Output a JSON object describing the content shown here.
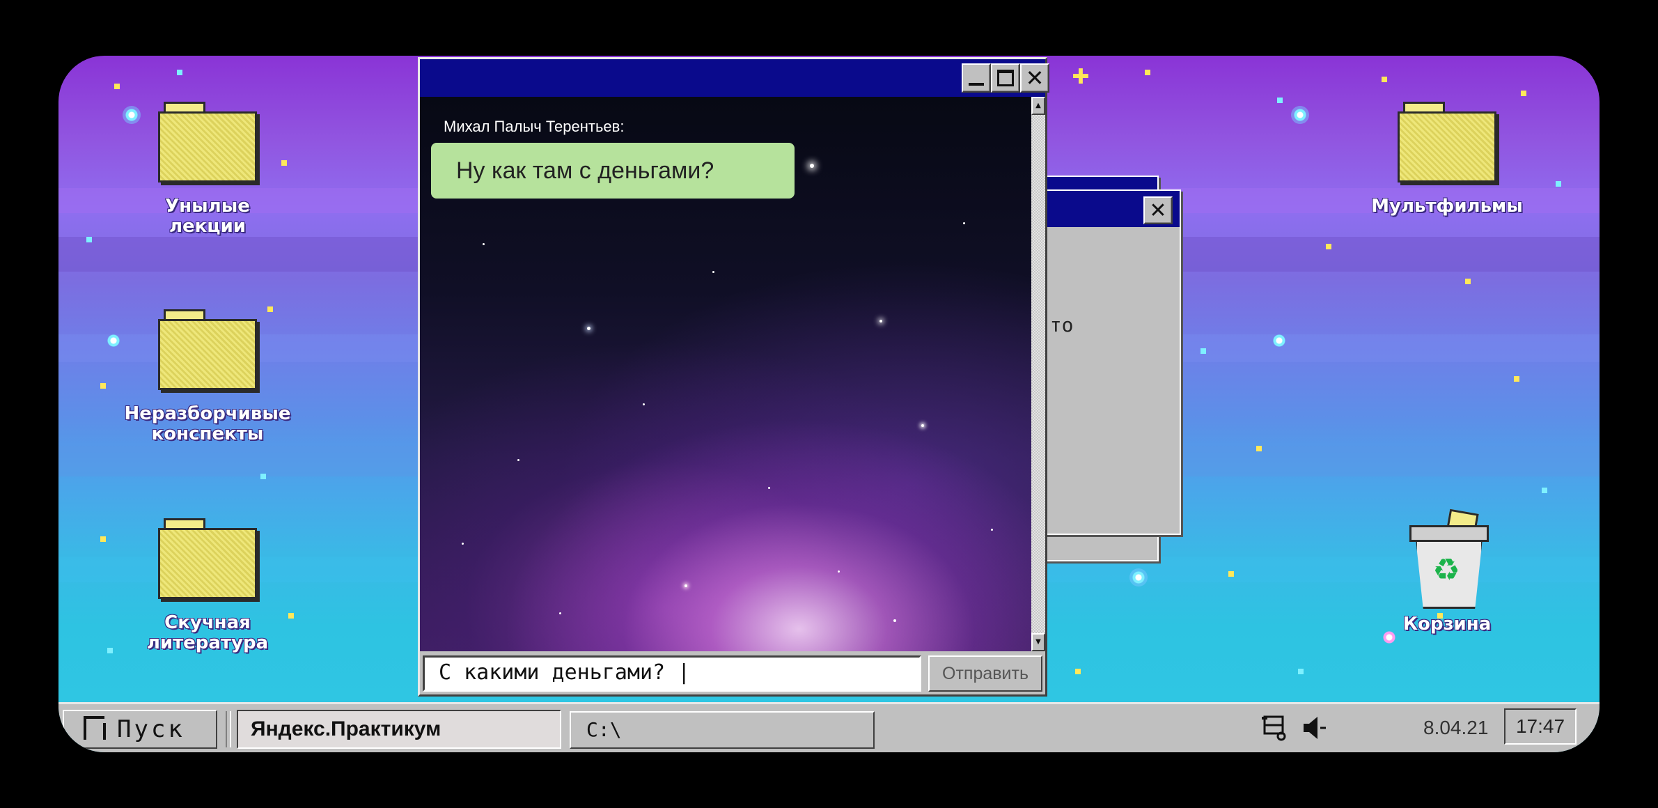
{
  "desktop": {
    "icons_left": [
      {
        "label_line1": "Унылые",
        "label_line2": "лекции"
      },
      {
        "label_line1": "Неразборчивые",
        "label_line2": "конспекты"
      },
      {
        "label_line1": "Скучная",
        "label_line2": "литература"
      }
    ],
    "icons_right": [
      {
        "label_line1": "Мультфильмы",
        "label_line2": ""
      },
      {
        "label_line1": "Корзина",
        "label_line2": ""
      }
    ]
  },
  "back_dialog": {
    "partial_text": "о-то"
  },
  "chat_window": {
    "title": "",
    "sender": "Михал Палыч Терентьев:",
    "message": "Ну как там с деньгами?",
    "input_value": "С какими деньгами? |",
    "send_label": "Отправить"
  },
  "taskbar": {
    "start_label": "Пуск",
    "tasks": [
      {
        "label": "Яндекс.Практикум"
      },
      {
        "label": "C:\\"
      }
    ],
    "date": "8.04.21",
    "time": "17:47"
  },
  "colors": {
    "titlebar": "#0a0a8c",
    "chrome": "#c0c0c0",
    "bubble": "#b6e29c",
    "folder": "#eee77a"
  },
  "icons": [
    "folder-icon",
    "trash-icon",
    "recycle-icon",
    "network-icon",
    "speaker-icon",
    "minimize-icon",
    "maximize-icon",
    "close-icon"
  ]
}
